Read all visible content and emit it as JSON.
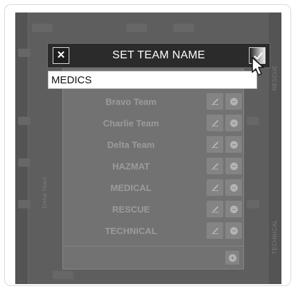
{
  "dialog": {
    "title": "SET TEAM NAME",
    "close_glyph": "✕",
    "input_value": "MEDICS"
  },
  "teams": [
    {
      "name": "Bravo Team"
    },
    {
      "name": "Charlie Team"
    },
    {
      "name": "Delta Team"
    },
    {
      "name": "HAZMAT"
    },
    {
      "name": "MEDICAL"
    },
    {
      "name": "RESCUE"
    },
    {
      "name": "TECHNICAL"
    }
  ],
  "background": {
    "side_labels": [
      "Delta Team",
      "RESCUE",
      "TECHNICAL"
    ]
  },
  "icons": {
    "close": "close-icon",
    "confirm": "check-icon",
    "edit": "pencil-icon",
    "delete": "minus-circle-icon",
    "add": "plus-circle-icon",
    "pointer": "mouse-pointer-icon"
  },
  "colors": {
    "dialog_bar": "#2b2b2b",
    "overlay": "#5e5e5e",
    "input_bg": "#ffffff"
  }
}
